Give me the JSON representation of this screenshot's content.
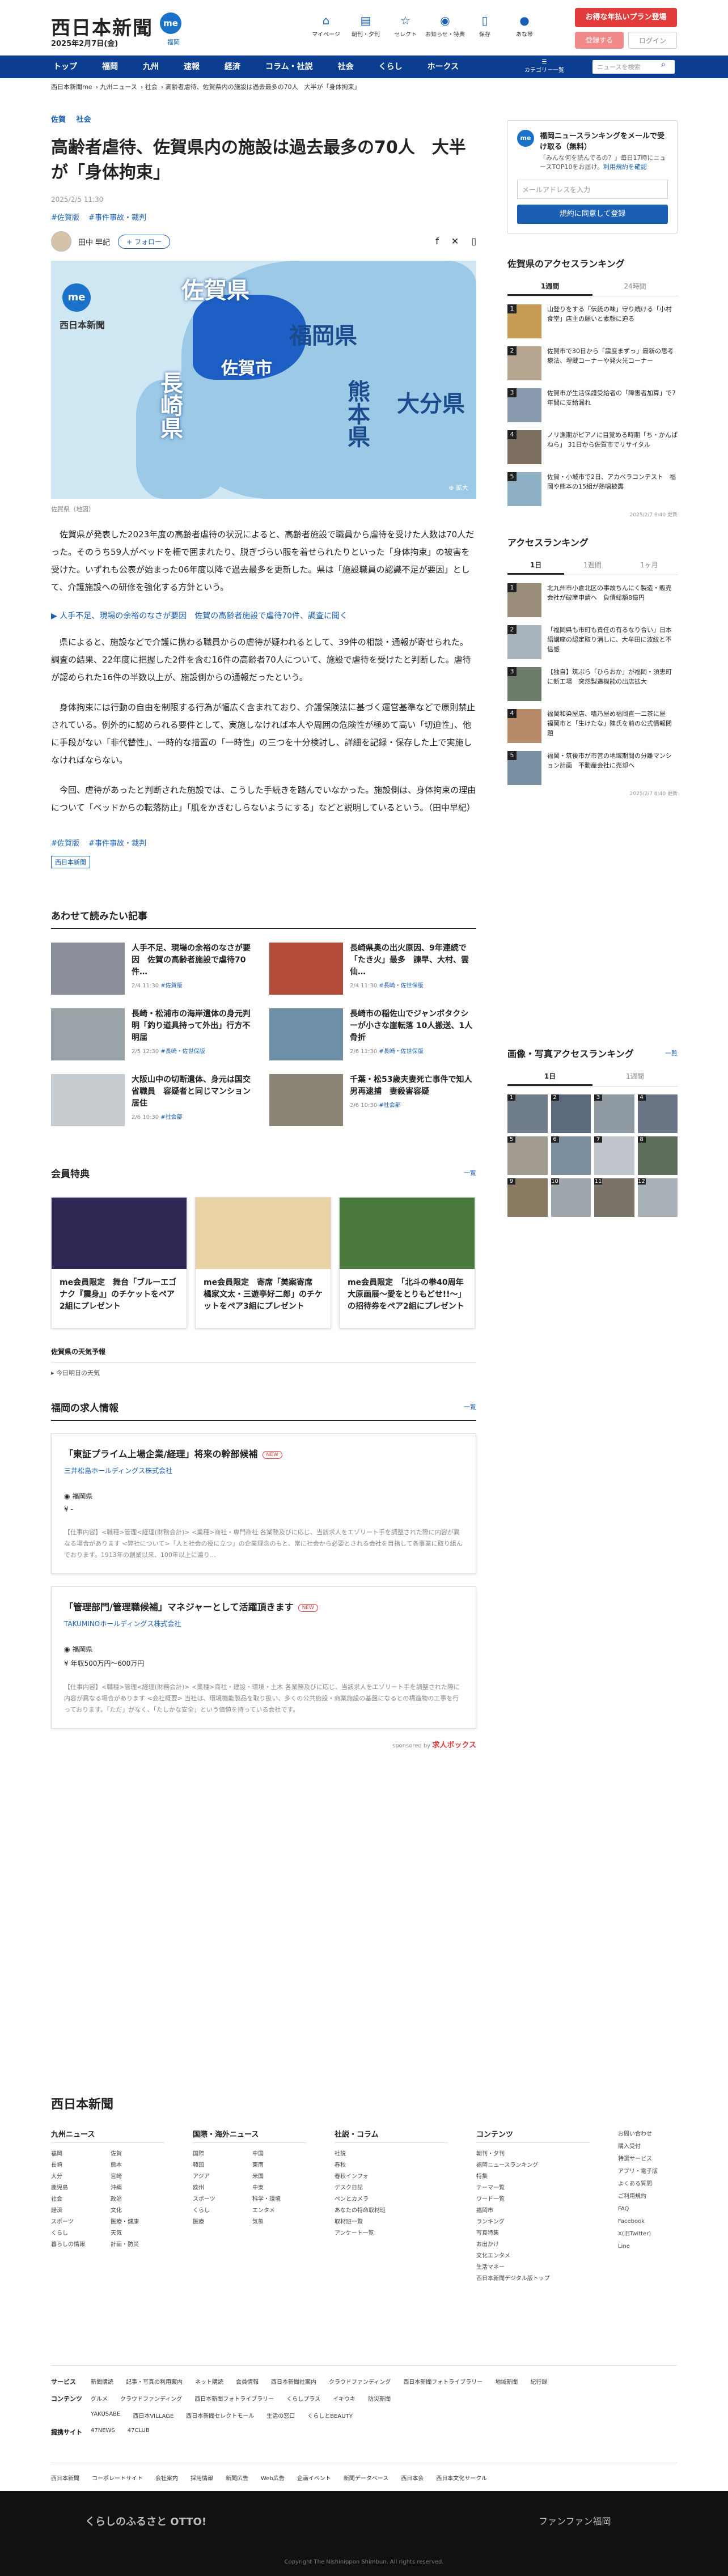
{
  "header": {
    "logo": "西日本新聞",
    "date": "2025年2月7日(金)",
    "me": "me",
    "me_sub": "福岡",
    "tools": [
      {
        "icon": "home-icon",
        "label": "マイページ"
      },
      {
        "icon": "news-icon",
        "label": "朝刊・夕刊"
      },
      {
        "icon": "select-icon",
        "label": "セレクト"
      },
      {
        "icon": "notice-icon",
        "label": "お知らせ・特典"
      },
      {
        "icon": "save-icon",
        "label": "保存"
      },
      {
        "icon": "me-icon",
        "label": "あな帯"
      }
    ],
    "campaign": "お得な年払いプラン登場",
    "register": "登録する",
    "login": "ログイン"
  },
  "nav": {
    "items": [
      "トップ",
      "福岡",
      "九州",
      "速報",
      "経済",
      "コラム・社説",
      "社会",
      "くらし",
      "ホークス"
    ],
    "menu": "カテゴリー一覧",
    "search_placeholder": "ニュースを検索"
  },
  "breadcrumb": [
    "西日本新聞me",
    "九州ニュース",
    "社会",
    "高齢者虐待、佐賀県内の施設は過去最多の70人　大半が「身体拘束」"
  ],
  "article": {
    "categories": [
      "佐賀",
      "社会"
    ],
    "title": "高齢者虐待、佐賀県内の施設は過去最多の70人　大半が「身体拘束」",
    "date": "2025/2/5 11:30",
    "tags": [
      "#佐賀版",
      "#事件事故・裁判"
    ],
    "author": "田中 早紀",
    "follow": "+ フォロー",
    "map": {
      "labels": [
        "佐賀県",
        "佐賀市",
        "福岡県",
        "大分県",
        "長崎県",
        "熊本県"
      ],
      "brand": "西日本新聞",
      "zoom": "拡大"
    },
    "caption": "佐賀県（地図）",
    "paragraphs": [
      "佐賀県が発表した2023年度の高齢者虐待の状況によると、高齢者施設で職員から虐待を受けた人数は70人だった。そのうち59人がベッドを柵で囲まれたり、脱ぎづらい服を着せられたりといった「身体拘束」の被害を受けた。いずれも公表が始まった06年度以降で過去最多を更新した。県は「施設職員の認識不足が要因」として、介護施設への研修を強化する方針という。",
      "県によると、施設などで介護に携わる職員からの虐待が疑われるとして、39件の相談・通報が寄せられた。調査の結果、22年度に把握した2件を含む16件の高齢者70人について、施設で虐待を受けたと判断した。虐待が認められた16件の半数以上が、施設側からの通報だったという。",
      "身体拘束には行動の自由を制限する行為が幅広く含まれており、介護保険法に基づく運営基準などで原則禁止されている。例外的に認められる要件として、実施しなければ本人や周囲の危険性が極めて高い「切迫性」、他に手段がない「非代替性」、一時的な措置の「一時性」の三つを十分検討し、詳細を記録・保存した上で実施しなければならない。",
      "今回、虐待があったと判断された施設では、こうした手続きを踏んでいなかった。施設側は、身体拘束の理由について「ベッドからの転落防止」「肌をかきむしらないようにする」などと説明しているという。（田中早紀）"
    ],
    "related": "▶ 人手不足、現場の余裕のなさが要因　佐賀の高齢者施設で虐待70件、調査に聞く",
    "bottom_tags": [
      "#佐賀版",
      "#事件事故・裁判"
    ],
    "press": "西日本新聞"
  },
  "readalso": {
    "title": "あわせて読みたい記事",
    "items": [
      {
        "title": "人手不足、現場の余裕のなさが要因　佐賀の高齢者施設で虐待70件…",
        "date": "2/4 11:30",
        "tag": "#佐賀版"
      },
      {
        "title": "長崎県奥の出火原因、9年連続で「たき火」最多　諫早、大村、雲仙…",
        "date": "2/4 11:30",
        "tag": "#長崎・佐世保版"
      },
      {
        "title": "長崎・松浦市の海岸遺体の身元判明「釣り道具持って外出」行方不明届",
        "date": "2/5 12:30",
        "tag": "#長崎・佐世保版"
      },
      {
        "title": "長崎市の稲佐山でジャンボタクシーが小さな崖転落 10人搬送、1人骨折",
        "date": "2/6 11:30",
        "tag": "#長崎・佐世保版"
      },
      {
        "title": "大阪山中の切断遺体、身元は国交省職員　容疑者と同じマンション居住",
        "date": "2/6 10:30",
        "tag": "#社会部"
      },
      {
        "title": "千葉・松53歳夫妻死亡事件で知人男再逮捕　妻殺害容疑",
        "date": "2/6 10:30",
        "tag": "#社会部"
      }
    ]
  },
  "perks": {
    "title": "会員特典",
    "more": "一覧",
    "items": [
      {
        "text": "me会員限定　舞台「ブルーエゴナク『震身』」のチケットをペア2組にプレゼント"
      },
      {
        "text": "me会員限定　寄席「美案寄席　橘家文太・三遊亭好二郎」のチケットをペア3組にプレゼント"
      },
      {
        "text": "me会員限定　「北斗の拳40周年大原画展～愛をとりもどせ!!～」の招待券をペア2組にプレゼント"
      }
    ]
  },
  "weather": {
    "title": "佐賀県の天気予報",
    "sub": "今日明日の天気"
  },
  "jobs": {
    "title": "福岡の求人情報",
    "more": "一覧",
    "items": [
      {
        "title": "「東証プライム上場企業/経理」将来の幹部候補",
        "new": "NEW",
        "company": "三井松島ホールディングス株式会社",
        "location": "福岡県",
        "salary": "-",
        "desc": "【仕事内容】<職種>管理<経理(財務会計)> <業種>商社・専門商社 各業務及びに応じ、当該求人をエゾリート手を調整された際に内容が異なる場合があります <弊社について>「人と社会の役に立つ」の企業理念のもと、常に社会から必要とされる会社を目指して各事業に取り組んでおります。1913年の創業以来、100年以上に渡り…"
      },
      {
        "title": "「管理部門/管理職候補」マネジャーとして活躍頂きます",
        "new": "NEW",
        "company": "TAKUMINOホールディングス株式会社",
        "location": "福岡県",
        "salary": "年収500万円〜600万円",
        "desc": "【仕事内容】<職種>管理<経理(財務会計)> <業種>商社・建設・環境・土木 各業務及びに応じ、当該求人をエゾリート手を調整された際に内容が異なる場合があります <会社概要> 当社は、環境機能製品を取り扱い、多くの公共施設・商業施設の基盤になるとの構造物の工事を行っております。「ただ」がなく、「たしかな安全」という価値を持っている会社です。"
      }
    ],
    "sponsor": "sponsored by",
    "sponsor_brand": "求人ボックス"
  },
  "sidebar": {
    "newsletter": {
      "title": "福岡ニュースランキングをメールで受け取る（無料）",
      "desc": "「みんな何を読んでるの？」毎日17時にニュースTOP10をお届け。",
      "link": "利用規約を確認",
      "placeholder": "メールアドレスを入力",
      "button": "規約に同意して登録"
    },
    "rank1": {
      "title": "佐賀県のアクセスランキング",
      "tabs": [
        "1週間",
        "24時間"
      ],
      "items": [
        "山登りをする「伝統の味」守り続ける「小村食堂」店主の願いと素顔に迫る",
        "佐賀市で30日から「震度まずっ」最新の思考療法、埋蔵コーナーや発火光コーナー",
        "佐賀市が生活保護受給者の「障害者加算」で7年間に支給漏れ",
        "ノリ漁期がピアノに目覚める時期「ち・かんぱねら」 31日から佐賀市でリサイタル",
        "佐賀・小城市で2日、アカペラコンテスト　福岡や熊本の15組が熱唱披露"
      ],
      "updated": "2025/2/7 8:40 更新"
    },
    "rank2": {
      "title": "アクセスランキング",
      "tabs": [
        "1日",
        "1週間",
        "1ヶ月"
      ],
      "items": [
        "北九州市小倉北区の事故ちんにく製造・販売会社が破産申請へ　負債総額8億円",
        "「福岡県も市町も責任の有るなり合い」日本語講座の認定取り消しに、大牟田に波紋と不信感",
        "【独自】筑ぷら「ひらおか」が福岡・須恵町に新工場　突然製造機能の出店拡大",
        "福岡和染屋店、嗜乃屋め福岡直一二茶に屋　福岡市と「生けたな」陳氏を前の公式情報問題",
        "福岡・筑後市が市営の地域期間の分離マンション計画　不動産会社に売却へ"
      ],
      "updated": "2025/2/7 8:40 更新"
    },
    "rank3": {
      "title": "画像・写真アクセスランキング",
      "more": "一覧",
      "tabs": [
        "1日",
        "1週間"
      ]
    }
  },
  "footer": {
    "logo": "西日本新聞",
    "cols": [
      {
        "title": "九州ニュース",
        "items": [
          "福岡",
          "佐賀",
          "長崎",
          "熊本",
          "大分",
          "宮崎",
          "鹿児島",
          "沖縄",
          "社会",
          "政治",
          "経済",
          "文化",
          "スポーツ",
          "医療・健康",
          "くらし",
          "天気",
          "暮らしの情報",
          "計画・防災"
        ]
      },
      {
        "title": "国際・海外ニュース",
        "items": [
          "国際",
          "中国",
          "韓国",
          "東南",
          "アジア",
          "米国",
          "欧州",
          "中東",
          "スポーツ",
          "科学・環境",
          "くらし",
          "エンタメ",
          "医療",
          "気象"
        ]
      },
      {
        "title": "社説・コラム",
        "items": [
          "社説",
          "春秋",
          "春秋インフォ",
          "デスク日記",
          "ペンとカメラ",
          "あなたの特命取材班",
          "取材班一覧",
          "アンケート一覧"
        ]
      },
      {
        "title": "コンテンツ",
        "items": [
          "朝刊・夕刊",
          "福岡ニュースランキング",
          "特集",
          "テーマ一覧",
          "ワード一覧",
          "福岡市",
          "ランキング",
          "写真特集",
          "お出かけ",
          "文化エンタメ",
          "生活マネー",
          "西日本新聞デジタル版トップ"
        ]
      }
    ],
    "sns": [
      "お問い合わせ",
      "購入受付",
      "特選サービス",
      "アプリ・電子版",
      "よくある質問",
      "ご利用規約",
      "FAQ",
      "Facebook",
      "X(旧Twitter)",
      "Line"
    ],
    "services": [
      {
        "label": "サービス",
        "items": [
          "新聞購読",
          "記事・写真の利用案内",
          "ネット購読",
          "会員情報",
          "西日本新聞社案内",
          "クラウドファンディング",
          "西日本新聞フォトライブラリー",
          "地域新聞",
          "紀行録"
        ]
      },
      {
        "label": "コンテンツ",
        "items": [
          "グルメ",
          "クラウドファンディング",
          "西日本新聞フォトライブラリー",
          "くらしプラス",
          "イキウキ",
          "防災新聞"
        ]
      },
      {
        "label": "",
        "items": [
          "YAKUSABE",
          "西日本VILLAGE",
          "西日本新聞セレクトモール",
          "生活の窓口",
          "くらしとBEAUTY"
        ]
      },
      {
        "label": "提携サイト",
        "items": [
          "47NEWS",
          "47CLUB"
        ]
      }
    ],
    "corp": [
      "西日本新聞",
      "コーポレートサイト",
      "会社案内",
      "採用情報",
      "新聞広告",
      "Web広告",
      "企画イベント",
      "新聞データベース",
      "西日本会",
      "西日本文化サークル"
    ],
    "brand_left": "くらしのふるさと OTTO!",
    "brand_right": "ファンファン福岡",
    "copyright": "Copyright The Nishinippon Shimbun. All rights reserved."
  }
}
